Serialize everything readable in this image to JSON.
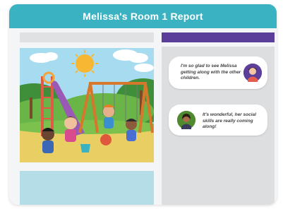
{
  "report": {
    "title": "Melissa's Room 1 Report"
  },
  "messages": [
    {
      "text": "I'm so glad to see Melissa getting along with the other children.",
      "sender": "parent"
    },
    {
      "text": "It's wonderful, her social skills are really coming along!",
      "sender": "teacher"
    }
  ],
  "colors": {
    "header": "#3ab2c2",
    "accent_bar": "#5a3e99",
    "caption_box": "#b5dde8",
    "panel": "#dcdedf"
  },
  "illustration": {
    "icon": "playground-illustration"
  }
}
